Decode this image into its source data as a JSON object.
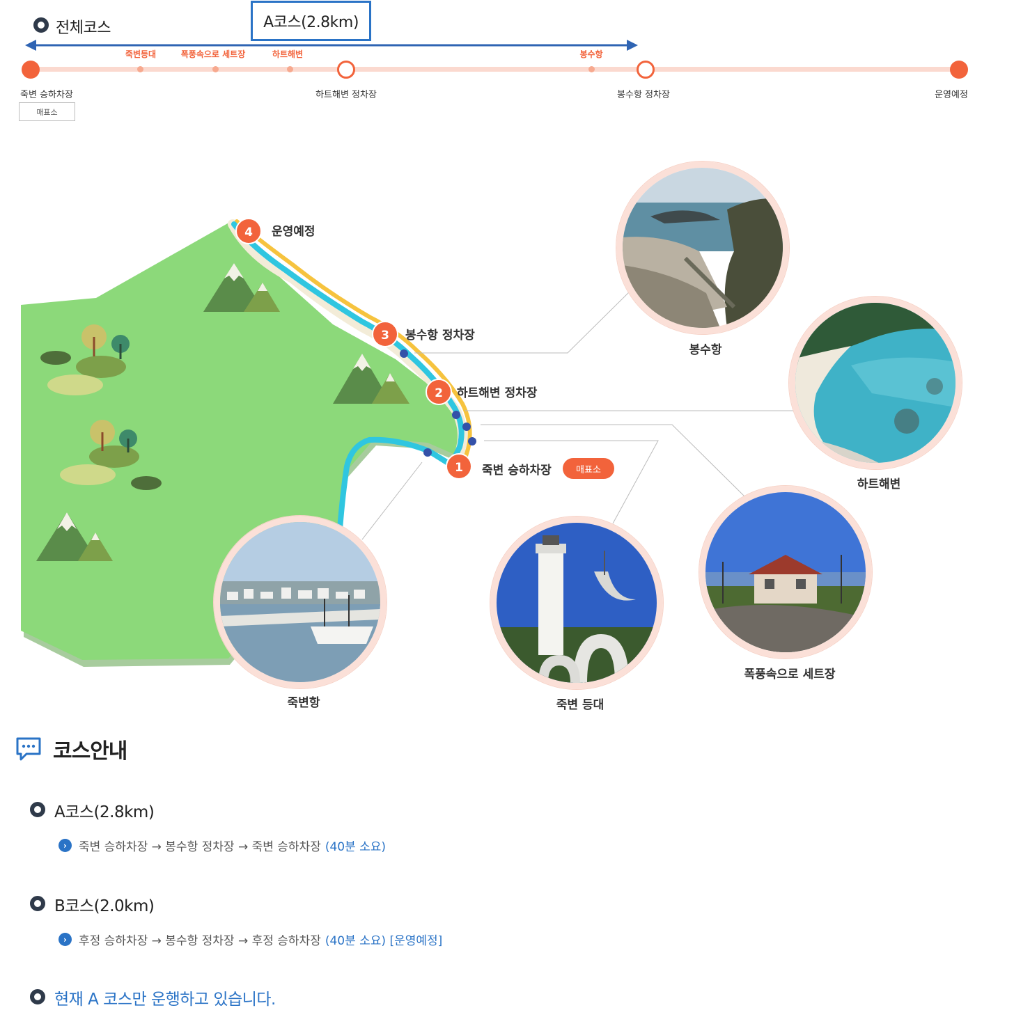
{
  "timeline": {
    "all_course_label": "전체코스",
    "selected_course_label": "A코스(2.8km)",
    "points_of_interest": [
      "죽변등대",
      "폭풍속으로 세트장",
      "하트해변",
      "봉수항"
    ],
    "stops": [
      "죽변 승하차장",
      "하트해변 정차장",
      "봉수항 정차장",
      "운영예정"
    ],
    "ticket_label": "매표소"
  },
  "map": {
    "stops": [
      {
        "number": "1",
        "label": "죽변 승하차장"
      },
      {
        "number": "2",
        "label": "하트해변 정차장"
      },
      {
        "number": "3",
        "label": "봉수항 정차장"
      },
      {
        "number": "4",
        "label": "운영예정"
      }
    ],
    "ticket_label": "매표소",
    "photos": [
      "봉수항",
      "하트해변",
      "죽변항",
      "죽변 등대",
      "폭풍속으로 세트장"
    ]
  },
  "guide": {
    "title": "코스안내",
    "courses": [
      {
        "name": "A코스(2.8km)",
        "route": "죽변 승하차장 → 봉수항 정차장 → 죽변 승하차장",
        "note": "(40분 소요)"
      },
      {
        "name": "B코스(2.0km)",
        "route": "후정 승하차장 → 봉수항 정차장 → 후정 승하차장",
        "note": "(40분 소요) [운영예정]"
      }
    ],
    "notice": "현재 A 코스만 운행하고 있습니다."
  },
  "colors": {
    "accent": "#f2633b",
    "blue": "#2a73c6",
    "land": "#8cd97a",
    "sea_route": "#2fc6e0",
    "walk_route": "#f6c33e"
  }
}
